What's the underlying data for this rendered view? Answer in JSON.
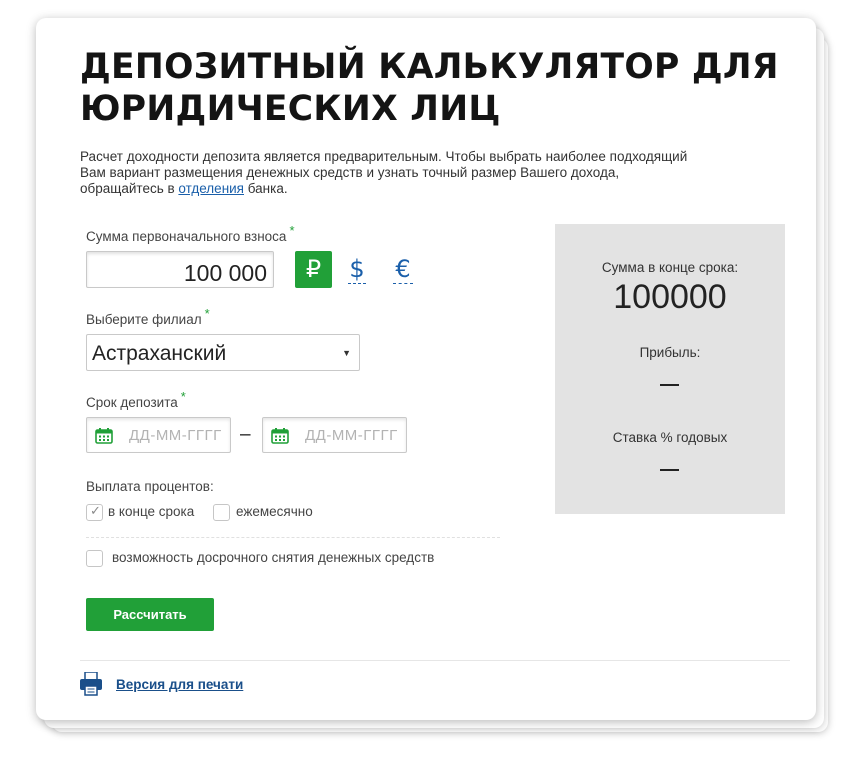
{
  "title": "ДЕПОЗИТНЫЙ КАЛЬКУЛЯТОР ДЛЯ ЮРИДИЧЕСКИХ ЛИЦ",
  "intro": {
    "text_before": "Расчет доходности депозита является предварительным. Чтобы выбрать наиболее подходящий Вам вариант размещения денежных средств и узнать точный размер Вашего дохода, обращайтесь в ",
    "link": "отделения",
    "text_after": " банка."
  },
  "required_mark": "*",
  "amount": {
    "label": "Сумма первоначального взноса",
    "value": "100 000",
    "currencies": {
      "rub": "₽",
      "usd": "$",
      "eur": "€"
    },
    "selected_currency": "rub"
  },
  "branch": {
    "label": "Выберите филиал",
    "value": "Астраханский"
  },
  "term": {
    "label": "Срок депозита",
    "from_placeholder": "ДД-ММ-ГГГГ",
    "separator": "–",
    "to_placeholder": "ДД-ММ-ГГГГ"
  },
  "payout": {
    "label": "Выплата процентов:",
    "end_of_term": {
      "label": "в конце срока",
      "checked": true
    },
    "monthly": {
      "label": "ежемесячно",
      "checked": false
    }
  },
  "early_withdrawal": {
    "label": "возможность досрочного снятия денежных средств",
    "checked": false
  },
  "calculate_button": "Рассчитать",
  "print_link": "Версия для печати",
  "result": {
    "sum_label": "Сумма в конце срока:",
    "sum_value": "100000",
    "profit_label": "Прибыль:",
    "rate_label": "Ставка % годовых"
  },
  "colors": {
    "accent_green": "#21a038",
    "link_blue": "#1a5faa",
    "result_bg": "#e3e3e3"
  }
}
